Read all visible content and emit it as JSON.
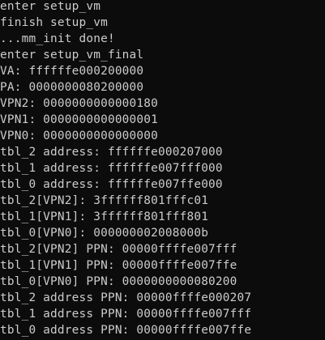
{
  "terminal": {
    "lines": [
      "enter setup_vm",
      "finish setup_vm",
      "...mm_init done!",
      "enter setup_vm_final",
      "VA: ffffffe000200000",
      "PA: 0000000080200000",
      "VPN2: 0000000000000180",
      "VPN1: 0000000000000001",
      "VPN0: 0000000000000000",
      "tbl_2 address: ffffffe000207000",
      "tbl_1 address: ffffffe007fff000",
      "tbl_0 address: ffffffe007ffe000",
      "tbl_2[VPN2]: 3ffffff801fffc01",
      "tbl_1[VPN1]: 3ffffff801fff801",
      "tbl_0[VPN0]: 000000002008000b",
      "tbl_2[VPN2] PPN: 00000ffffe007fff",
      "tbl_1[VPN1] PPN: 00000ffffe007ffe",
      "tbl_0[VPN0] PPN: 0000000000080200",
      "tbl_2 address PPN: 00000ffffe000207",
      "tbl_1 address PPN: 00000ffffe007fff",
      "tbl_0 address PPN: 00000ffffe007ffe"
    ]
  }
}
